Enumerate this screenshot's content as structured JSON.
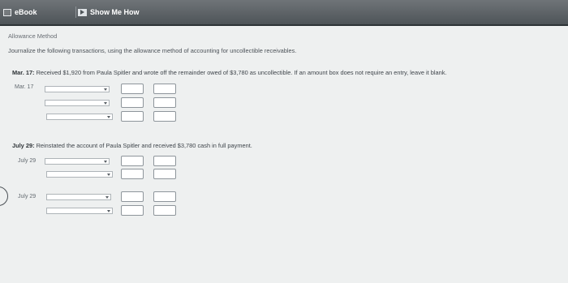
{
  "toolbar": {
    "ebook_label": "eBook",
    "ebook_icon": "book-icon",
    "showme_label": "Show Me How",
    "showme_icon": "video-play-icon"
  },
  "heading": "Allowance Method",
  "instruction": "Journalize the following transactions, using the allowance method of accounting for uncollectible receivables.",
  "transactions": [
    {
      "date_bold": "Mar. 17:",
      "text": " Received $1,920 from Paula Spitler and wrote off the remainder owed of $3,780 as uncollectible. If an amount box does not require an entry, leave it blank.",
      "entries": [
        {
          "date_label": "Mar. 17",
          "rows": 3
        }
      ]
    },
    {
      "date_bold": "July 29:",
      "text": " Reinstated the account of Paula Spitler and received $3,780 cash in full payment.",
      "entries": [
        {
          "date_label": "July 29",
          "rows": 2
        },
        {
          "date_label": "July 29",
          "rows": 2
        }
      ]
    }
  ]
}
